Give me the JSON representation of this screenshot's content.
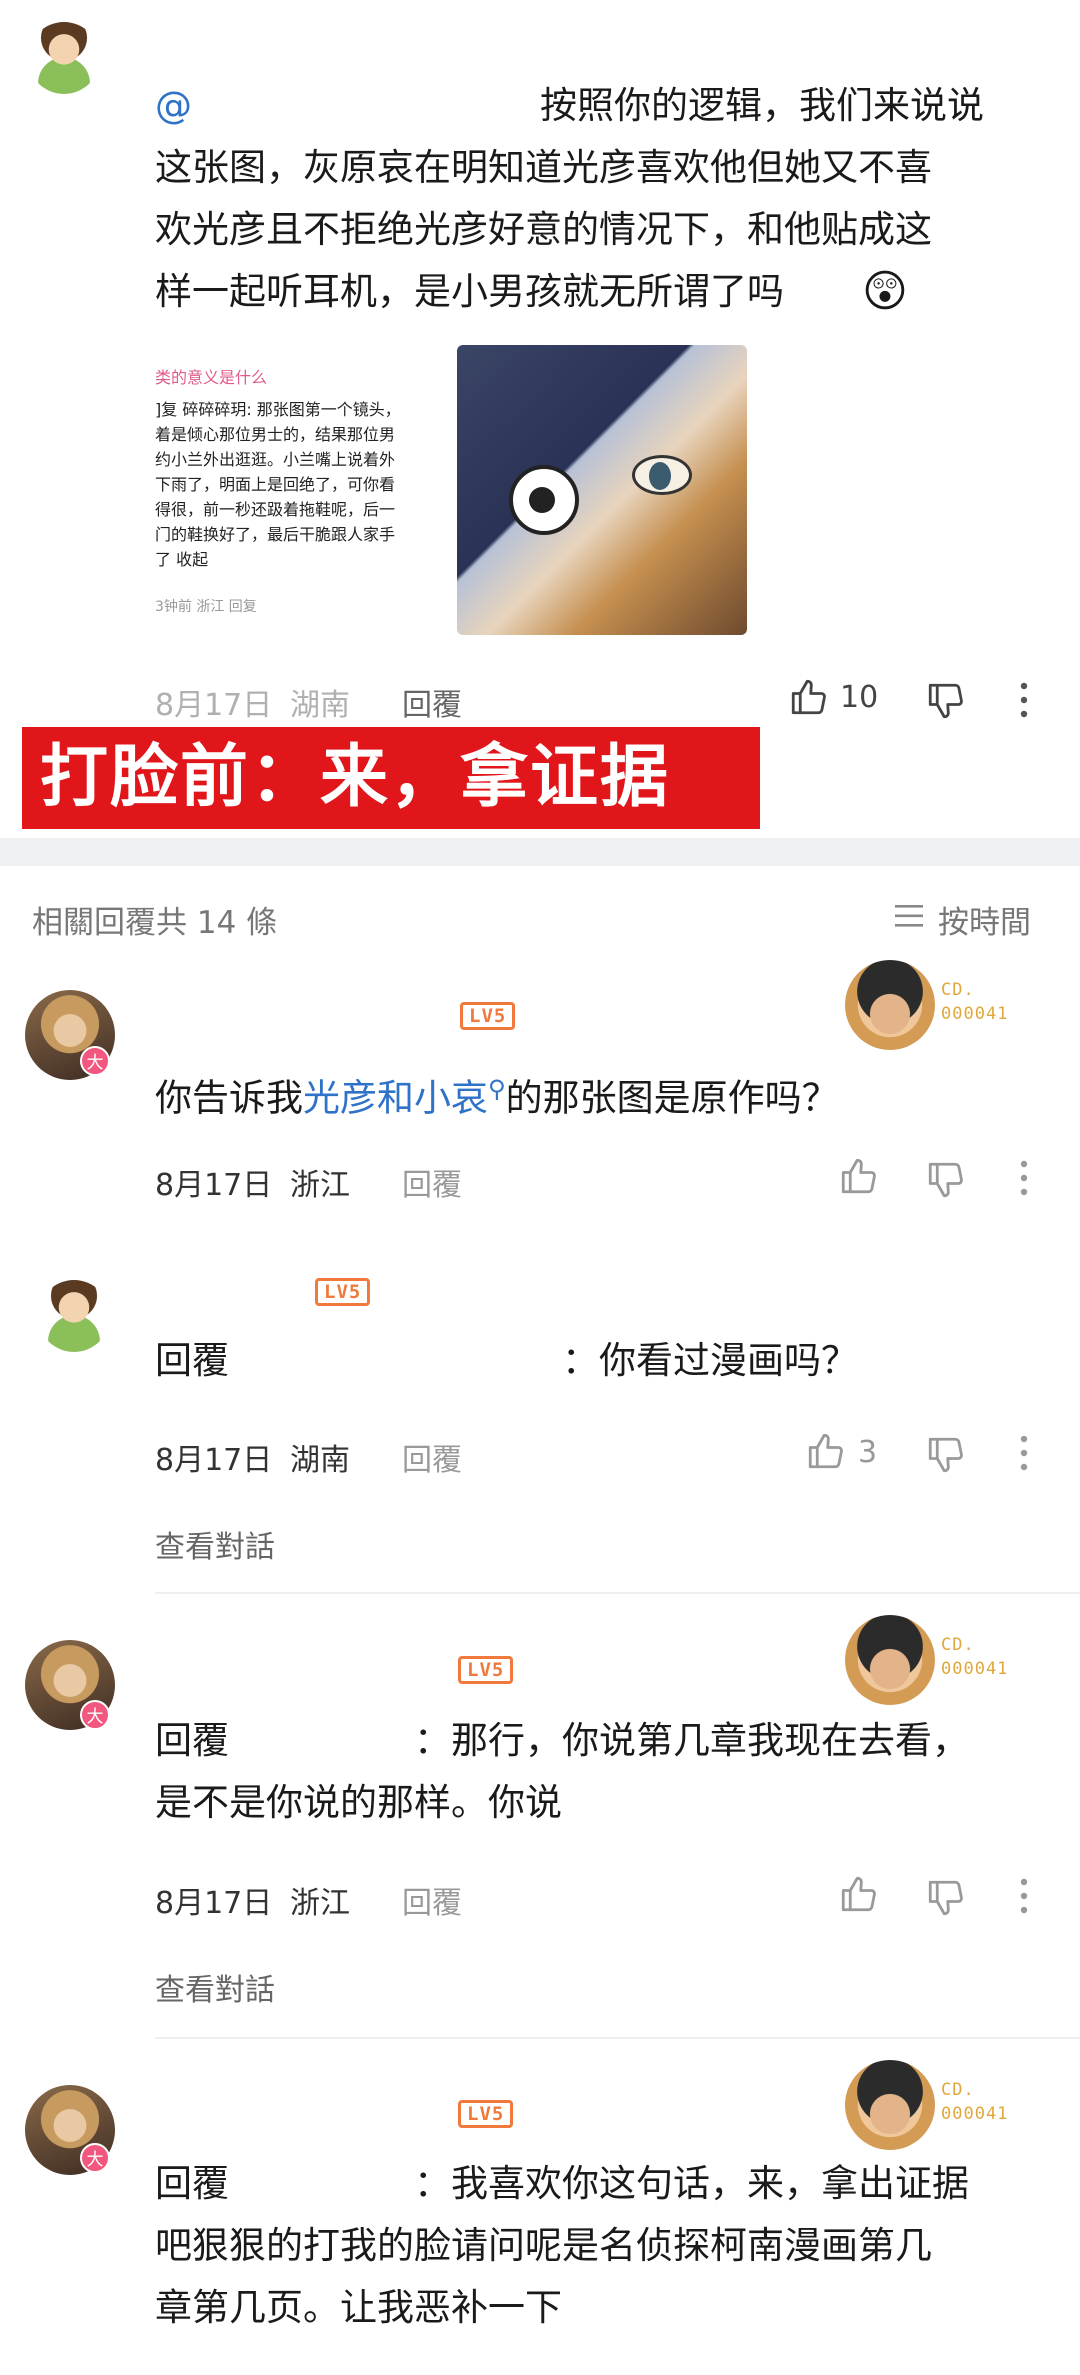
{
  "top_comment": {
    "mention": "@",
    "lines": [
      "按照你的逻辑，我们来说说",
      "这张图，灰原哀在明知道光彦喜欢他但她又不喜",
      "欢光彦且不拒绝光彦好意的情况下，和他贴成这",
      "样一起听耳机，是小男孩就无所谓了吗"
    ],
    "emoji": "😲",
    "date": "8月17日",
    "region": "湖南",
    "reply": "回覆",
    "likes": "10",
    "screenshot_lines": [
      "类的意义是什么",
      "]复 碎碎碎玥: 那张图第一个镜头，",
      "着是倾心那位男士的，结果那位男",
      "约小兰外出逛逛。小兰嘴上说着外",
      "下雨了，明面上是回绝了，可你看",
      "得很，前一秒还趿着拖鞋呢，后一",
      "门的鞋换好了，最后干脆跟人家手",
      "了 收起",
      "3钟前 浙江   回复"
    ]
  },
  "banner": "打脸前：来，拿证据",
  "related": {
    "header": "相關回覆共 14 條",
    "sort_label": "按時間"
  },
  "replies": [
    {
      "level": "LV5",
      "fan_code": [
        "CD.",
        "000041"
      ],
      "text_before": "你告诉我",
      "link": "光彦和小哀",
      "text_after": "的那张图是原作吗？",
      "date": "8月17日",
      "region": "浙江",
      "reply": "回覆"
    },
    {
      "level": "LV5",
      "text": "回覆　　　　　　　　　：你看过漫画吗？",
      "date": "8月17日",
      "region": "湖南",
      "reply": "回覆",
      "likes": "3",
      "view_conversation": "查看對話"
    },
    {
      "level": "LV5",
      "fan_code": [
        "CD.",
        "000041"
      ],
      "lines": [
        "回覆　　　　　：那行，你说第几章我现在去看，",
        "是不是你说的那样。你说"
      ],
      "date": "8月17日",
      "region": "浙江",
      "reply": "回覆",
      "view_conversation": "查看對話"
    },
    {
      "level": "LV5",
      "fan_code": [
        "CD.",
        "000041"
      ],
      "lines": [
        "回覆　　　　　：我喜欢你这句话，来，拿出证据",
        "吧狠狠的打我的脸请问呢是名侦探柯南漫画第几",
        "章第几页。让我恶补一下"
      ]
    }
  ],
  "avatar_badge": "大"
}
